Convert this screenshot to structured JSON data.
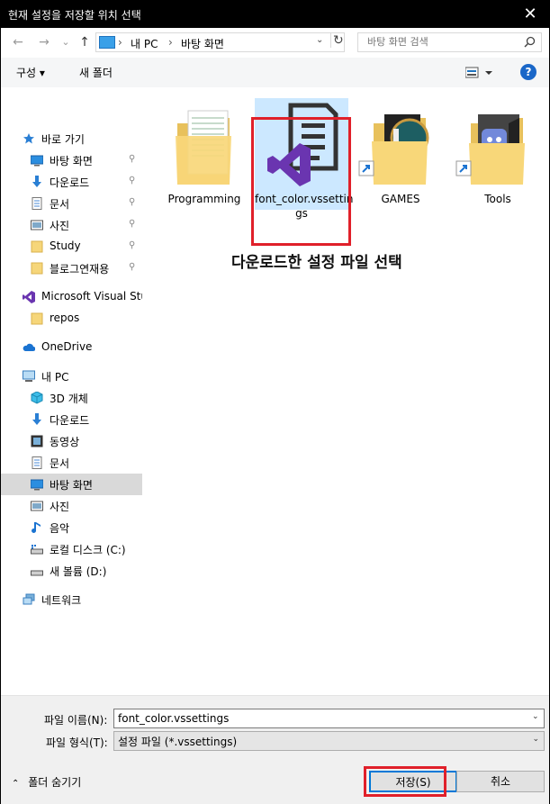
{
  "window": {
    "title": "현재 설정을 저장할 위치 선택",
    "close_glyph": "✕"
  },
  "nav": {
    "back_glyph": "←",
    "forward_glyph": "→",
    "recent_glyph": "⌄",
    "up_glyph": "↑",
    "breadcrumb": [
      "내 PC",
      "바탕 화면"
    ],
    "search_placeholder": "바탕 화면 검색"
  },
  "toolbar": {
    "organize_label": "구성 ▾",
    "new_folder_label": "새 폴더",
    "help_label": "?"
  },
  "sidebar": {
    "items": [
      {
        "label": "바로 가기",
        "icon": "star-icon",
        "pinned": false
      },
      {
        "label": "바탕 화면",
        "icon": "desktop-icon",
        "pinned": true
      },
      {
        "label": "다운로드",
        "icon": "download-icon",
        "pinned": true
      },
      {
        "label": "문서",
        "icon": "document-icon",
        "pinned": true
      },
      {
        "label": "사진",
        "icon": "picture-icon",
        "pinned": true
      },
      {
        "label": "Study",
        "icon": "folder-icon",
        "pinned": true
      },
      {
        "label": "블로그연재용",
        "icon": "folder-icon",
        "pinned": true
      },
      {
        "label": "Microsoft Visual Stuc",
        "icon": "visual-studio-icon",
        "pinned": false
      },
      {
        "label": "repos",
        "icon": "folder-icon",
        "pinned": false
      },
      {
        "label": "OneDrive",
        "icon": "cloud-icon",
        "pinned": false
      },
      {
        "label": "내 PC",
        "icon": "computer-icon",
        "pinned": false
      },
      {
        "label": "3D 개체",
        "icon": "cube-icon",
        "pinned": false
      },
      {
        "label": "다운로드",
        "icon": "download-icon",
        "pinned": false
      },
      {
        "label": "동영상",
        "icon": "video-icon",
        "pinned": false
      },
      {
        "label": "문서",
        "icon": "document-icon",
        "pinned": false
      },
      {
        "label": "바탕 화면",
        "icon": "desktop-icon",
        "pinned": false
      },
      {
        "label": "사진",
        "icon": "picture-icon",
        "pinned": false
      },
      {
        "label": "음악",
        "icon": "music-icon",
        "pinned": false
      },
      {
        "label": "로컬 디스크 (C:)",
        "icon": "drive-icon",
        "pinned": false
      },
      {
        "label": "새 볼륨 (D:)",
        "icon": "drive-icon",
        "pinned": false
      },
      {
        "label": "네트워크",
        "icon": "network-icon",
        "pinned": false
      }
    ],
    "pin_glyph": "📌"
  },
  "files": [
    {
      "label": "Programming",
      "icon": "folder-icon"
    },
    {
      "label": "font_color.vssettings",
      "icon": "vssettings-file-icon"
    },
    {
      "label": "GAMES",
      "icon": "folder-shortcut-icon"
    },
    {
      "label": "Tools",
      "icon": "folder-shortcut-icon"
    }
  ],
  "annotation": {
    "text": "다운로드한 설정 파일 선택"
  },
  "footer": {
    "filename_label": "파일 이름(N):",
    "filename_value": "font_color.vssettings",
    "filetype_label": "파일 형식(T):",
    "filetype_value": "설정 파일 (*.vssettings)",
    "hide_folders_label": "폴더 숨기기",
    "save_label": "저장(S)",
    "cancel_label": "취소"
  },
  "colors": {
    "accent": "#0078d7",
    "highlight": "#e0202a",
    "selected": "#cce8ff"
  }
}
